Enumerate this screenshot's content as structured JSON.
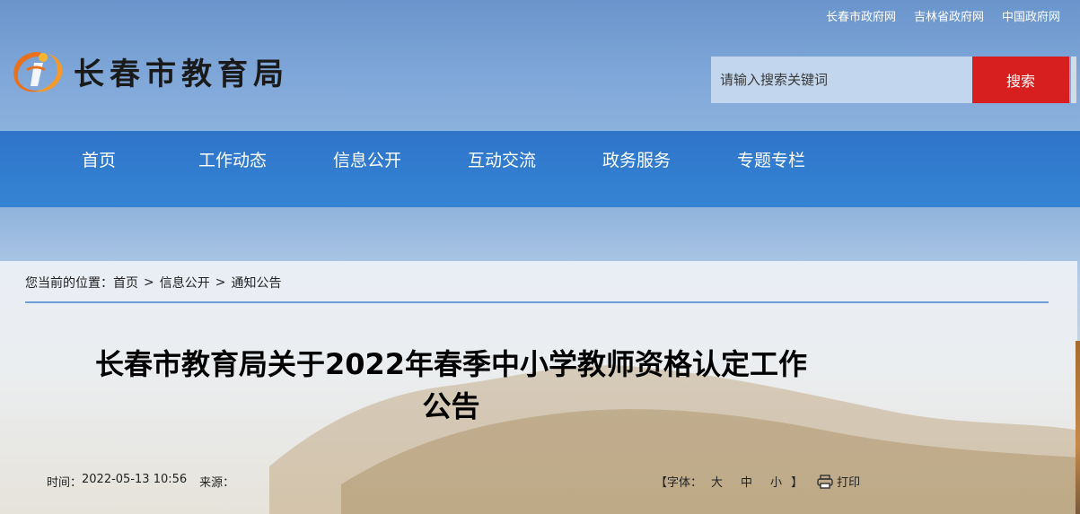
{
  "top_links": [
    "长春市政府网",
    "吉林省政府网",
    "中国政府网"
  ],
  "site": {
    "name": "长春市教育局"
  },
  "search": {
    "placeholder": "请输入搜索关键词",
    "button_label": "搜索"
  },
  "nav": {
    "items": [
      "首页",
      "工作动态",
      "信息公开",
      "互动交流",
      "政务服务",
      "专题专栏"
    ]
  },
  "breadcrumb": {
    "prefix": "您当前的位置：",
    "items": [
      "首页",
      "信息公开",
      "通知公告"
    ],
    "separator": ">"
  },
  "article": {
    "title_line1": "长春市教育局关于2022年春季中小学教师资格认定工作",
    "title_line2": "公告",
    "time_label": "时间：",
    "time_value": "2022-05-13 10:56",
    "source_label": "来源：",
    "font_label_open": "【字体：",
    "font_large": "大",
    "font_medium": "中",
    "font_small": "小",
    "font_label_close": "】",
    "print_label": "打印"
  },
  "colors": {
    "nav_bg": "#3584d4",
    "search_button": "#d81f1f",
    "breadcrumb_line": "#6d9fd6"
  }
}
